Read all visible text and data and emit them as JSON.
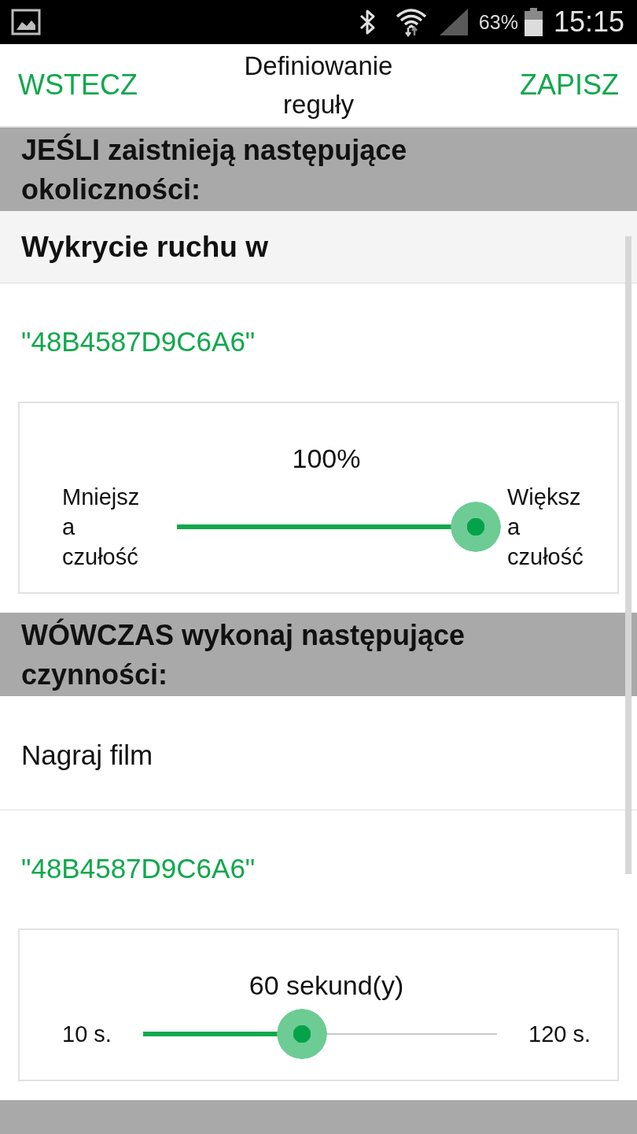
{
  "status_bar": {
    "battery": "63%",
    "time": "15:15"
  },
  "header": {
    "back": "WSTECZ",
    "title": "Definiowanie reguły",
    "save": "ZAPISZ"
  },
  "sections": [
    {
      "title": "JEŚLI zaistnieją następujące okoliczności:",
      "items": [
        {
          "kind": "heading",
          "text": "Wykrycie ruchu w"
        },
        {
          "kind": "device",
          "text": "\"48B4587D9C6A6\""
        },
        {
          "kind": "slider",
          "value": "100%",
          "min_label": "Mniejsz a czułość",
          "max_label": "Większ a czułość",
          "level": 1
        }
      ]
    },
    {
      "title": "WÓWCZAS wykonaj następujące czynności:",
      "items": [
        {
          "kind": "action",
          "text": "Nagraj film"
        },
        {
          "kind": "device",
          "text": "\"48B4587D9C6A6\""
        },
        {
          "kind": "slider",
          "value": "60 sekund(y)",
          "min_label": "10 s.",
          "max_label": "120 s.",
          "level": 0.45
        }
      ]
    }
  ]
}
